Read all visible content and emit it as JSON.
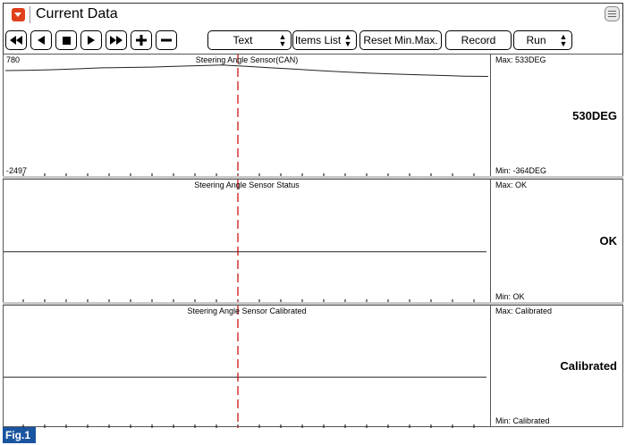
{
  "window": {
    "title": "Current Data"
  },
  "toolbar": {
    "view_mode": "Text",
    "items_list": "Items List",
    "reset_minmax": "Reset Min.Max.",
    "record": "Record",
    "run": "Run"
  },
  "panels": [
    {
      "title": "Steering Angle Sensor(CAN)",
      "y_top": "780",
      "y_bottom": "-2497",
      "max": "Max:  533DEG",
      "min": "Min:  -364DEG",
      "current": "530DEG"
    },
    {
      "title": "Steering Angle Sensor Status",
      "max": "Max: OK",
      "min": "Min:  OK",
      "current": "OK"
    },
    {
      "title": "Steering Angle Sensor Calibrated",
      "max": "Max: Calibrated",
      "min": "Min:  Calibrated",
      "current": "Calibrated"
    }
  ],
  "chart_data": {
    "type": "line",
    "ylim": [
      -2497,
      780
    ],
    "x": [
      0,
      1,
      2,
      3,
      4,
      5,
      6,
      7,
      8,
      9,
      10,
      11,
      12,
      13,
      14,
      15,
      16,
      17,
      18,
      19,
      20
    ],
    "series": [
      {
        "name": "Steering Angle Sensor(CAN)",
        "values": [
          420,
          430,
          445,
          470,
          500,
          510,
          520,
          540,
          560,
          580,
          540,
          500,
          460,
          420,
          380,
          350,
          320,
          300,
          280,
          260,
          250
        ]
      }
    ]
  },
  "figure_label": "Fig.1",
  "colors": {
    "accent": "#e0401a",
    "cursor": "#cc0000",
    "fig_label_bg": "#1a55a0"
  },
  "icons": [
    "dropdown-arrow-icon",
    "menu-icon",
    "rewind-icon",
    "step-back-icon",
    "stop-icon",
    "play-icon",
    "fast-forward-icon",
    "zoom-in-icon",
    "zoom-out-icon"
  ]
}
